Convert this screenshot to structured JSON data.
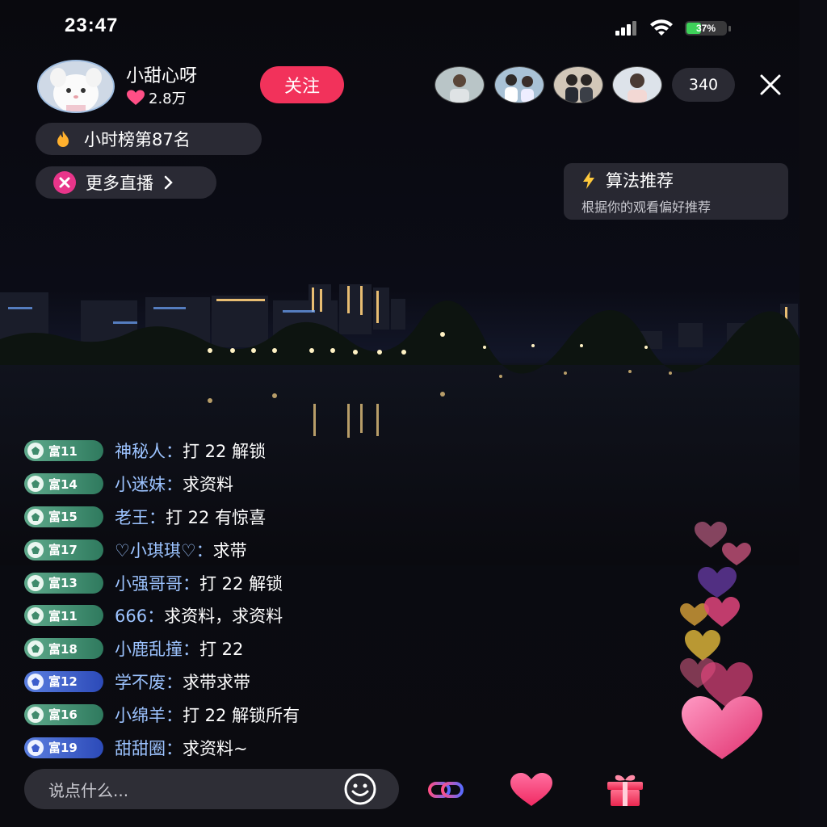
{
  "status_bar": {
    "time": "23:47",
    "battery_percent": "37%",
    "battery_level": 0.37
  },
  "streamer": {
    "name": "小甜心呀",
    "likes": "2.8万",
    "follow_label": "关注"
  },
  "viewers": {
    "count": "340"
  },
  "rank": {
    "label": "小时榜第87名"
  },
  "more_live": {
    "label": "更多直播"
  },
  "recommend": {
    "title": "算法推荐",
    "subtitle": "根据你的观看偏好推荐"
  },
  "chat": [
    {
      "level": "富11",
      "badge_color": "green",
      "user": "神秘人",
      "message": "打 22 解锁"
    },
    {
      "level": "富14",
      "badge_color": "green",
      "user": "小迷妹",
      "message": "求资料"
    },
    {
      "level": "富15",
      "badge_color": "green",
      "user": "老王",
      "message": "打 22 有惊喜"
    },
    {
      "level": "富17",
      "badge_color": "green",
      "user": "♡小琪琪♡",
      "message": "求带"
    },
    {
      "level": "富13",
      "badge_color": "green",
      "user": "小强哥哥",
      "message": "打 22 解锁"
    },
    {
      "level": "富11",
      "badge_color": "green",
      "user": "666",
      "message": "求资料，求资料"
    },
    {
      "level": "富18",
      "badge_color": "green",
      "user": "小鹿乱撞",
      "message": "打 22"
    },
    {
      "level": "富12",
      "badge_color": "blue",
      "user": "学不废",
      "message": "求带求带"
    },
    {
      "level": "富16",
      "badge_color": "green",
      "user": "小绵羊",
      "message": "打 22 解锁所有"
    },
    {
      "level": "富19",
      "badge_color": "blue",
      "user": "甜甜圈",
      "message": "求资料~"
    }
  ],
  "chat_separator": "：",
  "comment": {
    "placeholder": "说点什么..."
  },
  "colors": {
    "follow": "#f2325b",
    "username": "#9cc3ff",
    "heart": "#ff4f86",
    "battery": "#3ed15a"
  },
  "icons": [
    "signal-icon",
    "wifi-icon",
    "battery-icon",
    "heart-icon",
    "fire-icon",
    "live-icon",
    "chevron-right-icon",
    "lightning-icon",
    "close-icon",
    "emoji-icon",
    "link-icon",
    "like-icon",
    "gift-icon"
  ]
}
